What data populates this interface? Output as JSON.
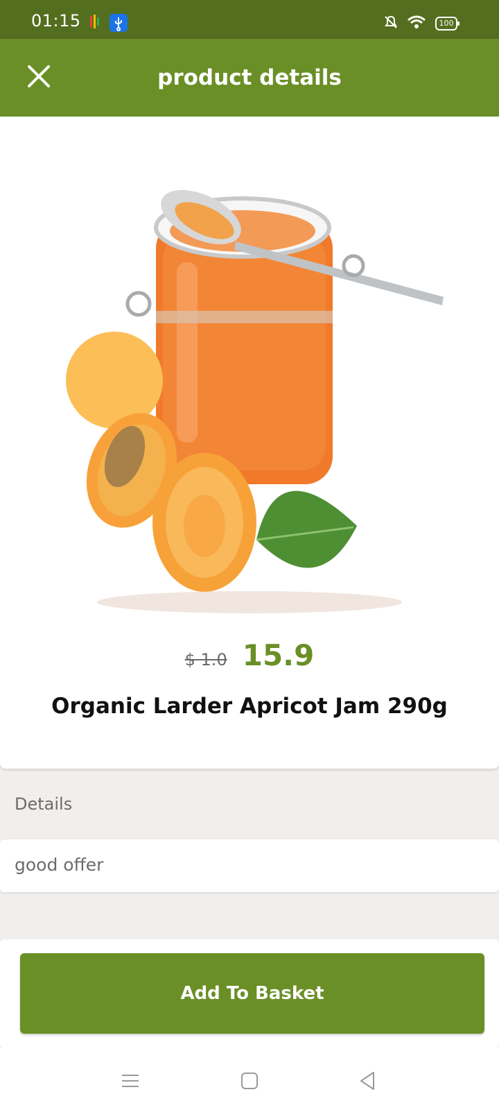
{
  "status_bar": {
    "time": "01:15",
    "battery": "100",
    "icons": [
      "google-photos-icon",
      "usb-icon",
      "bell-off-icon",
      "wifi-icon",
      "battery-icon"
    ]
  },
  "app_bar": {
    "title": "product details",
    "close_icon": "close-icon"
  },
  "product": {
    "old_price": "$ 1.0",
    "price": "15.9",
    "name": "Organic Larder Apricot Jam 290g"
  },
  "details": {
    "label": "Details",
    "text": "good offer"
  },
  "actions": {
    "add_to_basket": "Add To Basket"
  },
  "nav": {
    "icons": [
      "menu-icon",
      "home-icon",
      "back-icon"
    ]
  },
  "colors": {
    "status_bar": "#546e1f",
    "app_bar": "#6a8f26",
    "accent": "#6a8f26",
    "background": "#f1eeee"
  }
}
